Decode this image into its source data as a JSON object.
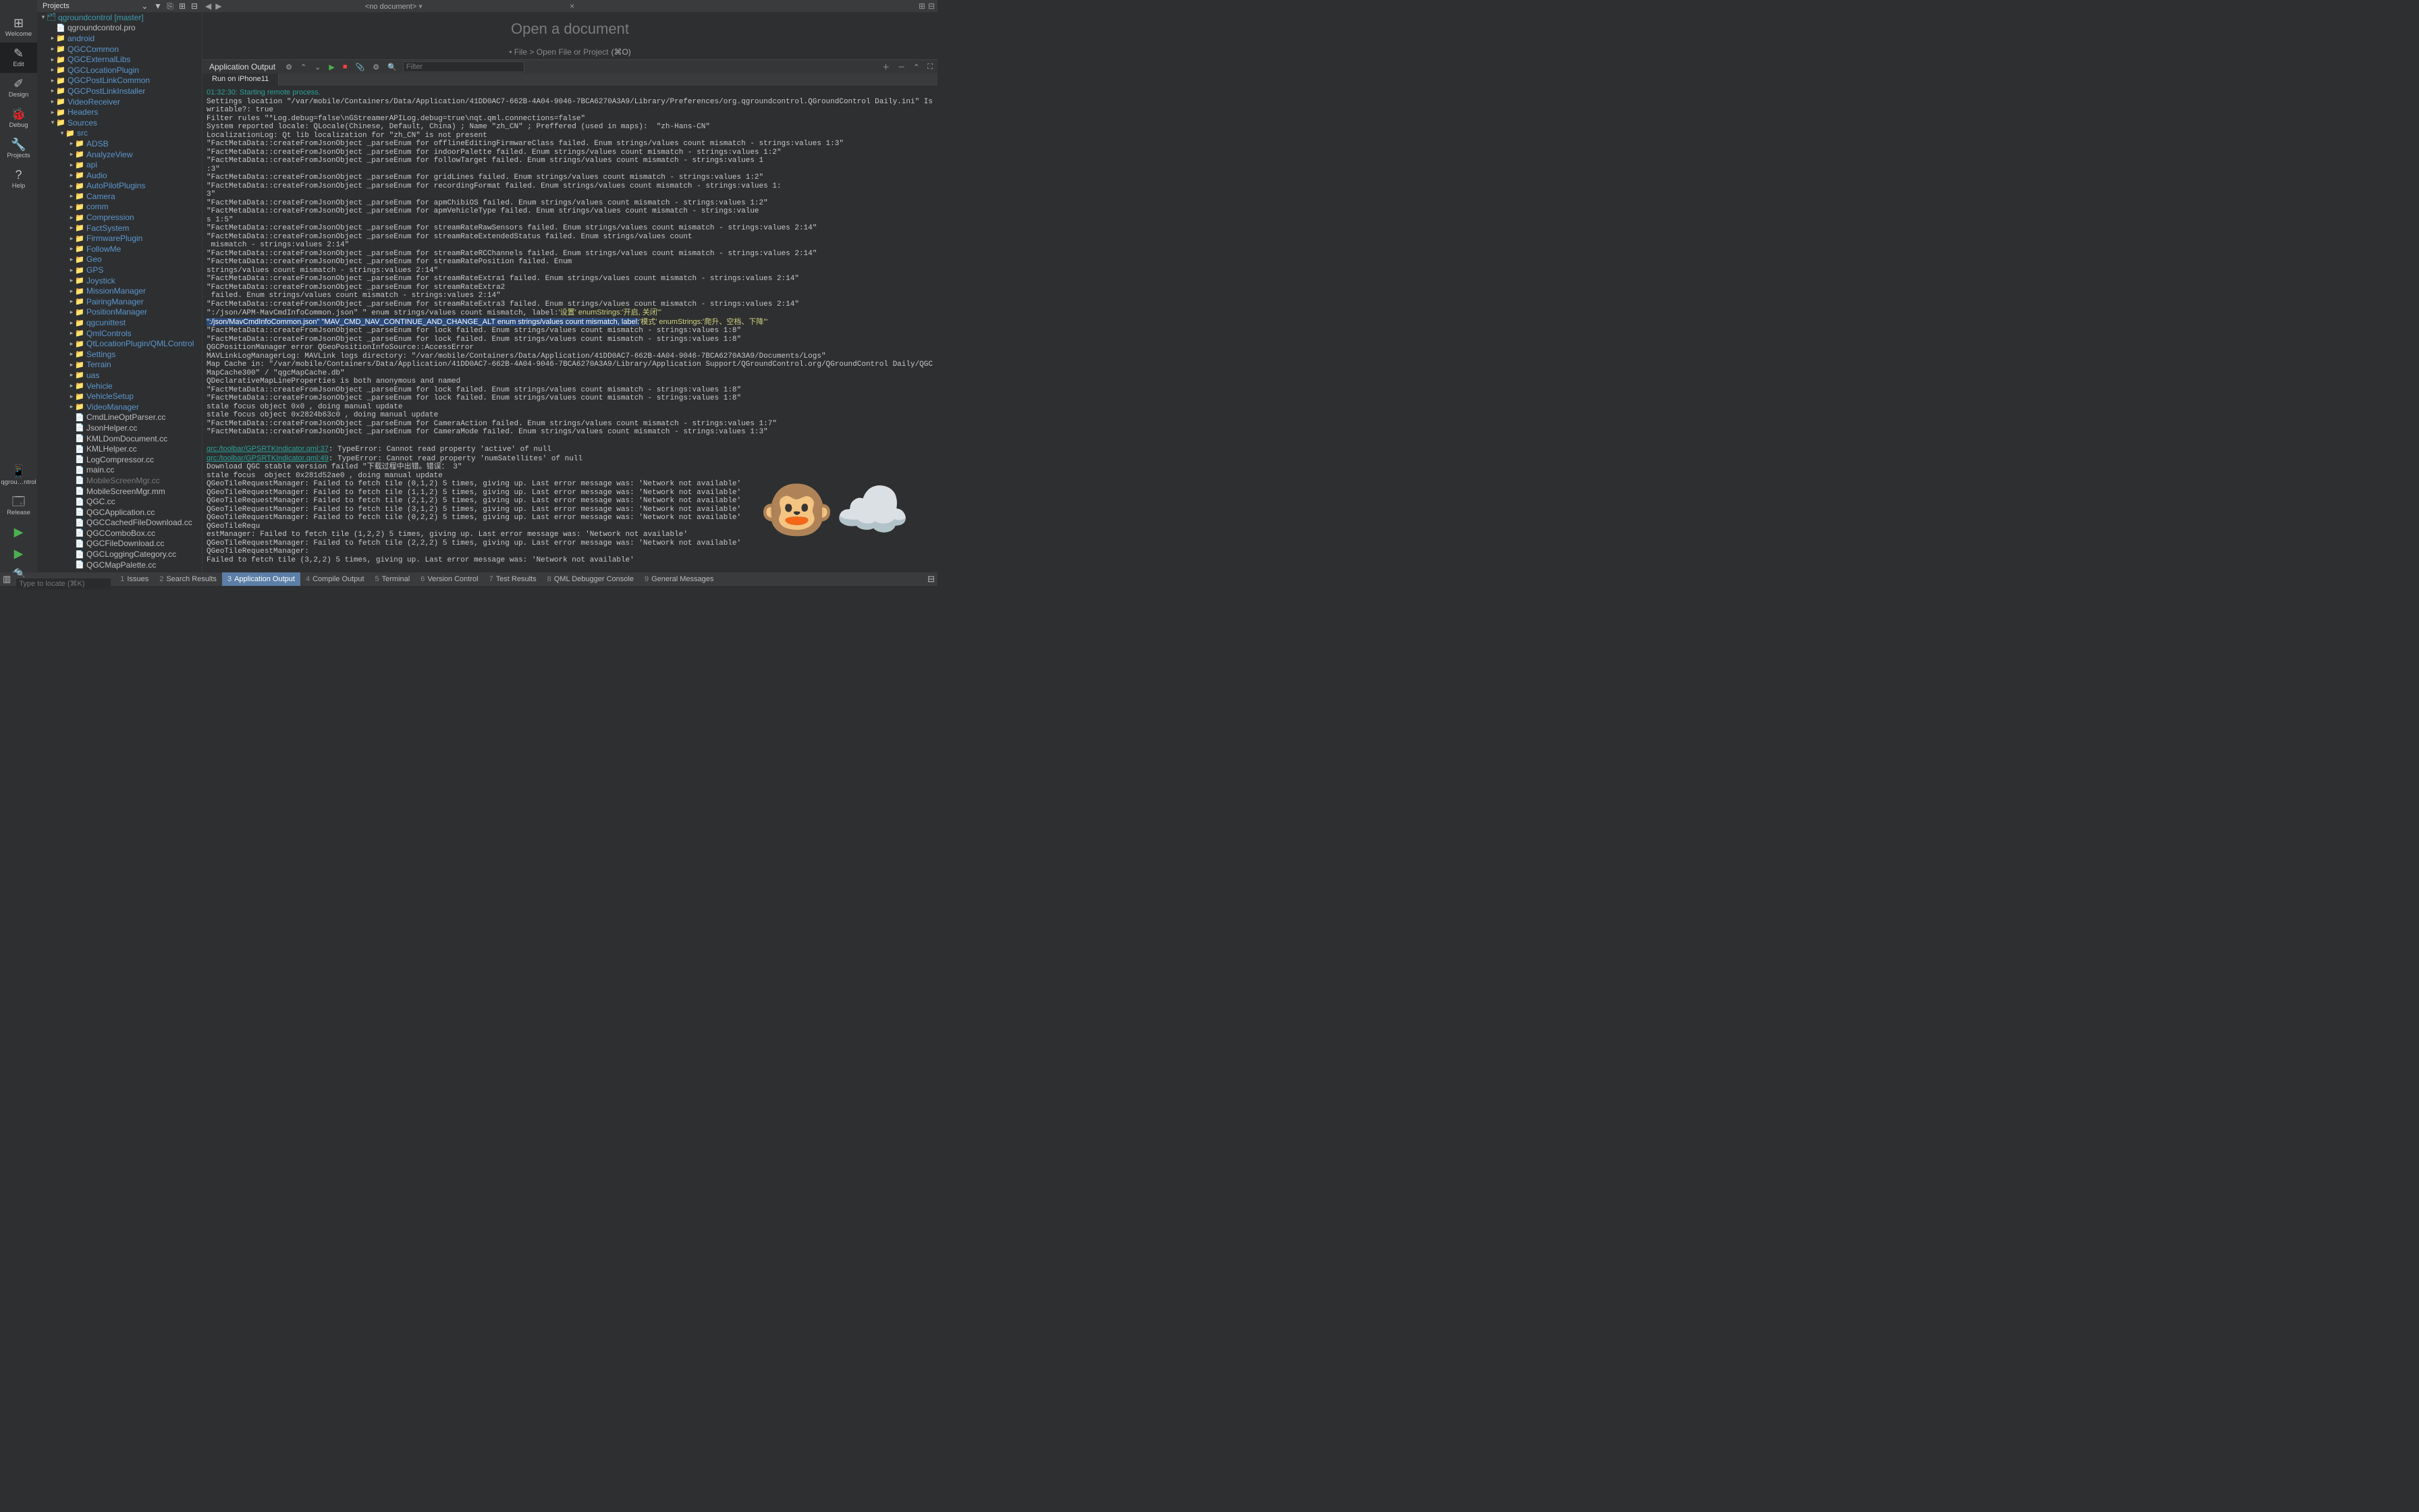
{
  "iconbar": {
    "items": [
      {
        "label": "Welcome",
        "glyph": "⊞"
      },
      {
        "label": "Edit",
        "glyph": "✎",
        "selected": true
      },
      {
        "label": "Design",
        "glyph": "✐"
      },
      {
        "label": "Debug",
        "glyph": "🐞"
      },
      {
        "label": "Projects",
        "glyph": "🔧"
      },
      {
        "label": "Help",
        "glyph": "?"
      }
    ],
    "bottom": [
      {
        "label": "qgrou…ntrol",
        "glyph": "📱"
      },
      {
        "label": "Release",
        "glyph": "🗔"
      }
    ],
    "run_glyph": "▶",
    "rundbg_glyph": "▶",
    "build_glyph": "🔨"
  },
  "treeheader": {
    "combo": "Projects",
    "icons": [
      "⌄",
      "⏷",
      "⧉",
      "⊞",
      "⊟"
    ]
  },
  "tree": [
    {
      "d": 0,
      "t": "proj",
      "a": "v",
      "n": "qgroundcontrol [master]"
    },
    {
      "d": 1,
      "t": "file",
      "a": "",
      "n": "qgroundcontrol.pro",
      "icon": "📄"
    },
    {
      "d": 1,
      "t": "folder",
      "a": ">",
      "n": "android"
    },
    {
      "d": 1,
      "t": "folder",
      "a": ">",
      "n": "QGCCommon"
    },
    {
      "d": 1,
      "t": "folder",
      "a": ">",
      "n": "QGCExternalLibs"
    },
    {
      "d": 1,
      "t": "folder",
      "a": ">",
      "n": "QGCLocationPlugin"
    },
    {
      "d": 1,
      "t": "folder",
      "a": ">",
      "n": "QGCPostLinkCommon"
    },
    {
      "d": 1,
      "t": "folder",
      "a": ">",
      "n": "QGCPostLinkInstaller"
    },
    {
      "d": 1,
      "t": "folder",
      "a": ">",
      "n": "VideoReceiver"
    },
    {
      "d": 1,
      "t": "folder",
      "a": ">",
      "n": "Headers"
    },
    {
      "d": 1,
      "t": "folder",
      "a": "v",
      "n": "Sources"
    },
    {
      "d": 2,
      "t": "folder",
      "a": "v",
      "n": "src"
    },
    {
      "d": 3,
      "t": "folder",
      "a": ">",
      "n": "ADSB"
    },
    {
      "d": 3,
      "t": "folder",
      "a": ">",
      "n": "AnalyzeView"
    },
    {
      "d": 3,
      "t": "folder",
      "a": ">",
      "n": "api"
    },
    {
      "d": 3,
      "t": "folder",
      "a": ">",
      "n": "Audio"
    },
    {
      "d": 3,
      "t": "folder",
      "a": ">",
      "n": "AutoPilotPlugins"
    },
    {
      "d": 3,
      "t": "folder",
      "a": ">",
      "n": "Camera"
    },
    {
      "d": 3,
      "t": "folder",
      "a": ">",
      "n": "comm"
    },
    {
      "d": 3,
      "t": "folder",
      "a": ">",
      "n": "Compression"
    },
    {
      "d": 3,
      "t": "folder",
      "a": ">",
      "n": "FactSystem"
    },
    {
      "d": 3,
      "t": "folder",
      "a": ">",
      "n": "FirmwarePlugin"
    },
    {
      "d": 3,
      "t": "folder",
      "a": ">",
      "n": "FollowMe"
    },
    {
      "d": 3,
      "t": "folder",
      "a": ">",
      "n": "Geo"
    },
    {
      "d": 3,
      "t": "folder",
      "a": ">",
      "n": "GPS"
    },
    {
      "d": 3,
      "t": "folder",
      "a": ">",
      "n": "Joystick"
    },
    {
      "d": 3,
      "t": "folder",
      "a": ">",
      "n": "MissionManager"
    },
    {
      "d": 3,
      "t": "folder",
      "a": ">",
      "n": "PairingManager"
    },
    {
      "d": 3,
      "t": "folder",
      "a": ">",
      "n": "PositionManager"
    },
    {
      "d": 3,
      "t": "folder",
      "a": ">",
      "n": "qgcunittest"
    },
    {
      "d": 3,
      "t": "folder",
      "a": ">",
      "n": "QmlControls"
    },
    {
      "d": 3,
      "t": "folder",
      "a": ">",
      "n": "QtLocationPlugin/QMLControl"
    },
    {
      "d": 3,
      "t": "folder",
      "a": ">",
      "n": "Settings"
    },
    {
      "d": 3,
      "t": "folder",
      "a": ">",
      "n": "Terrain"
    },
    {
      "d": 3,
      "t": "folder",
      "a": ">",
      "n": "uas"
    },
    {
      "d": 3,
      "t": "folder",
      "a": ">",
      "n": "Vehicle"
    },
    {
      "d": 3,
      "t": "folder",
      "a": ">",
      "n": "VehicleSetup"
    },
    {
      "d": 3,
      "t": "folder",
      "a": ">",
      "n": "VideoManager"
    },
    {
      "d": 3,
      "t": "file",
      "a": "",
      "n": "CmdLineOptParser.cc"
    },
    {
      "d": 3,
      "t": "file",
      "a": "",
      "n": "JsonHelper.cc"
    },
    {
      "d": 3,
      "t": "file",
      "a": "",
      "n": "KMLDomDocument.cc"
    },
    {
      "d": 3,
      "t": "file",
      "a": "",
      "n": "KMLHelper.cc"
    },
    {
      "d": 3,
      "t": "file",
      "a": "",
      "n": "LogCompressor.cc"
    },
    {
      "d": 3,
      "t": "file",
      "a": "",
      "n": "main.cc"
    },
    {
      "d": 3,
      "t": "dimfile",
      "a": "",
      "n": "MobileScreenMgr.cc"
    },
    {
      "d": 3,
      "t": "file",
      "a": "",
      "n": "MobileScreenMgr.mm"
    },
    {
      "d": 3,
      "t": "file",
      "a": "",
      "n": "QGC.cc"
    },
    {
      "d": 3,
      "t": "file",
      "a": "",
      "n": "QGCApplication.cc"
    },
    {
      "d": 3,
      "t": "file",
      "a": "",
      "n": "QGCCachedFileDownload.cc"
    },
    {
      "d": 3,
      "t": "file",
      "a": "",
      "n": "QGCComboBox.cc"
    },
    {
      "d": 3,
      "t": "file",
      "a": "",
      "n": "QGCFileDownload.cc"
    },
    {
      "d": 3,
      "t": "file",
      "a": "",
      "n": "QGCLoggingCategory.cc"
    },
    {
      "d": 3,
      "t": "file",
      "a": "",
      "n": "QGCMapPalette.cc"
    }
  ],
  "topbar": {
    "doc": "<no document>"
  },
  "editor": {
    "title": "Open a document",
    "hint_prefix": "• File > Open File or Project",
    "hint_shortcut": "(⌘O)"
  },
  "output": {
    "panel_title": "Application Output",
    "filter_placeholder": "Filter",
    "run_tab": "Run on iPhone11",
    "timestamp": "01:32:30: ",
    "timestamp_msg": "Starting remote process.",
    "lines": [
      "Settings location \"/var/mobile/Containers/Data/Application/41DD0AC7-662B-4A04-9046-7BCA6270A3A9/Library/Preferences/org.qgroundcontrol.QGroundControl Daily.ini\" Is writable?: true",
      "Filter rules \"*Log.debug=false\\nGStreamerAPILog.debug=true\\nqt.qml.connections=false\"",
      "System reported locale: QLocale(Chinese, Default, China) ; Name \"zh_CN\" ; Preffered (used in maps):  \"zh-Hans-CN\"",
      "LocalizationLog: Qt lib localization for \"zh_CN\" is not present",
      "\"FactMetaData::createFromJsonObject _parseEnum for offlineEditingFirmwareClass failed. Enum strings/values count mismatch - strings:values 1:3\"",
      "\"FactMetaData::createFromJsonObject _parseEnum for indoorPalette failed. Enum strings/values count mismatch - strings:values 1:2\"",
      "\"FactMetaData::createFromJsonObject _parseEnum for followTarget failed. Enum strings/values count mismatch - strings:values 1",
      ":3\"",
      "\"FactMetaData::createFromJsonObject _parseEnum for gridLines failed. Enum strings/values count mismatch - strings:values 1:2\"",
      "\"FactMetaData::createFromJsonObject _parseEnum for recordingFormat failed. Enum strings/values count mismatch - strings:values 1:",
      "3\"",
      "\"FactMetaData::createFromJsonObject _parseEnum for apmChibiOS failed. Enum strings/values count mismatch - strings:values 1:2\"",
      "\"FactMetaData::createFromJsonObject _parseEnum for apmVehicleType failed. Enum strings/values count mismatch - strings:value",
      "s 1:5\"",
      "\"FactMetaData::createFromJsonObject _parseEnum for streamRateRawSensors failed. Enum strings/values count mismatch - strings:values 2:14\"",
      "\"FactMetaData::createFromJsonObject _parseEnum for streamRateExtendedStatus failed. Enum strings/values count",
      " mismatch - strings:values 2:14\"",
      "\"FactMetaData::createFromJsonObject _parseEnum for streamRateRCChannels failed. Enum strings/values count mismatch - strings:values 2:14\"",
      "\"FactMetaData::createFromJsonObject _parseEnum for streamRatePosition failed. Enum",
      "strings/values count mismatch - strings:values 2:14\"",
      "\"FactMetaData::createFromJsonObject _parseEnum for streamRateExtra1 failed. Enum strings/values count mismatch - strings:values 2:14\"",
      "\"FactMetaData::createFromJsonObject _parseEnum for streamRateExtra2",
      " failed. Enum strings/values count mismatch - strings:values 2:14\"",
      "\"FactMetaData::createFromJsonObject _parseEnum for streamRateExtra3 failed. Enum strings/values count mismatch - strings:values 2:14\""
    ],
    "yellow1": "\":/json/APM-MavCmdInfoCommon.json\" \" enum strings/values count mismatch, label:",
    "yellow1b": "'设置' enumStrings:'开启, 关闭'\"",
    "hl_a": "\":/json/MavCmdInfoCommon.json\" \"MAV_CMD_NAV_CONTINUE_AND_CHANGE_ALT enum strings/values count mismatch, label:",
    "hl_b": "'模式' enumStrings:'爬升、空档、下降'\"",
    "lines2": [
      "\"FactMetaData::createFromJsonObject _parseEnum for lock failed. Enum strings/values count mismatch - strings:values 1:8\"",
      "\"FactMetaData::createFromJsonObject _parseEnum for lock failed. Enum strings/values count mismatch - strings:values 1:8\"",
      "QGCPositionManager error QGeoPositionInfoSource::AccessError",
      "MAVLinkLogManagerLog: MAVLink logs directory: \"/var/mobile/Containers/Data/Application/41DD0AC7-662B-4A04-9046-7BCA6270A3A9/Documents/Logs\"",
      "Map Cache in: \"/var/mobile/Containers/Data/Application/41DD0AC7-662B-4A04-9046-7BCA6270A3A9/Library/Application Support/QGroundControl.org/QGroundControl Daily/QGCMapCache300\" / \"qgcMapCache.db\"",
      "QDeclarativeMapLineProperties is both anonymous and named",
      "\"FactMetaData::createFromJsonObject _parseEnum for lock failed. Enum strings/values count mismatch - strings:values 1:8\"",
      "\"FactMetaData::createFromJsonObject _parseEnum for lock failed. Enum strings/values count mismatch - strings:values 1:8\"",
      "stale focus object 0x0 , doing manual update",
      "stale focus object 0x2824b63c0 , doing manual update",
      "\"FactMetaData::createFromJsonObject _parseEnum for CameraAction failed. Enum strings/values count mismatch - strings:values 1:7\"",
      "\"FactMetaData::createFromJsonObject _parseEnum for CameraMode failed. Enum strings/values count mismatch - strings:values 1:3\"",
      ""
    ],
    "link1": "qrc:/toolbar/GPSRTKIndicator.qml:37",
    "link1_msg": ": TypeError: Cannot read property 'active' of null",
    "link2": "qrc:/toolbar/GPSRTKIndicator.qml:49",
    "link2_msg": ": TypeError: Cannot read property 'numSatellites' of null",
    "lines3": [
      "Download QGC stable version failed \"下载过程中出错。错误： 3\"",
      "stale focus  object 0x281d52ae0 , doing manual update",
      "QGeoTileRequestManager: Failed to fetch tile (0,1,2) 5 times, giving up. Last error message was: 'Network not available'",
      "QGeoTileRequestManager: Failed to fetch tile (1,1,2) 5 times, giving up. Last error message was: 'Network not available'",
      "QGeoTileRequestManager: Failed to fetch tile (2,1,2) 5 times, giving up. Last error message was: 'Network not available'",
      "QGeoTileRequestManager: Failed to fetch tile (3,1,2) 5 times, giving up. Last error message was: 'Network not available'",
      "QGeoTileRequestManager: Failed to fetch tile (0,2,2) 5 times, giving up. Last error message was: 'Network not available'",
      "QGeoTileRequ",
      "estManager: Failed to fetch tile (1,2,2) 5 times, giving up. Last error message was: 'Network not available'",
      "QGeoTileRequestManager: Failed to fetch tile (2,2,2) 5 times, giving up. Last error message was: 'Network not available'",
      "QGeoTileRequestManager:",
      "Failed to fetch tile (3,2,2) 5 times, giving up. Last error message was: 'Network not available'"
    ]
  },
  "status": {
    "locate_placeholder": "Type to locate (⌘K)",
    "segs": [
      {
        "n": "1",
        "l": "Issues"
      },
      {
        "n": "2",
        "l": "Search Results"
      },
      {
        "n": "3",
        "l": "Application Output",
        "active": true
      },
      {
        "n": "4",
        "l": "Compile Output"
      },
      {
        "n": "5",
        "l": "Terminal"
      },
      {
        "n": "6",
        "l": "Version Control"
      },
      {
        "n": "7",
        "l": "Test Results"
      },
      {
        "n": "8",
        "l": "QML Debugger Console"
      },
      {
        "n": "9",
        "l": "General Messages"
      }
    ]
  }
}
